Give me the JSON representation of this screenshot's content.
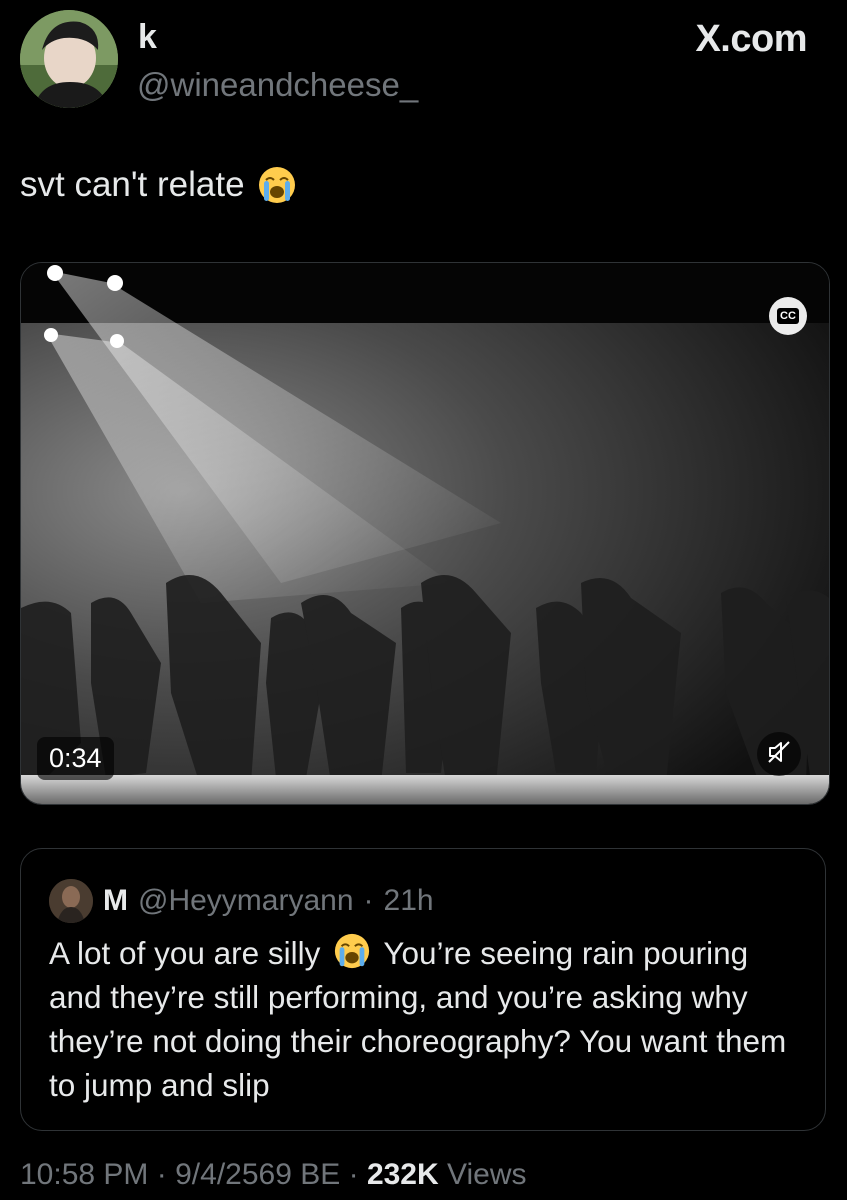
{
  "author": {
    "display_name": "k",
    "handle": "@wineandcheese_"
  },
  "brand": "X.com",
  "tweet": {
    "text": "svt can't relate",
    "emoji": "loudly-crying-face"
  },
  "media": {
    "duration": "0:34",
    "captions_label": "CC",
    "mute_icon": "speaker-muted-icon"
  },
  "quote": {
    "name": "M",
    "handle": "@Heyymaryann",
    "separator": "·",
    "time": "21h",
    "text_before_emoji": "A lot of you are silly",
    "emoji": "loudly-crying-face",
    "text_after_emoji": "You’re seeing rain pouring and they’re still performing, and you’re asking why they’re not doing their choreography? You want them to jump and slip"
  },
  "meta": {
    "time": "10:58 PM",
    "sep1": "·",
    "date": "9/4/2569 BE",
    "sep2": "·",
    "views_count": "232K",
    "views_label": "Views"
  },
  "colors": {
    "background": "#000000",
    "primary_text": "#e7e9ea",
    "secondary_text": "#71767b",
    "border": "#2f3336"
  }
}
